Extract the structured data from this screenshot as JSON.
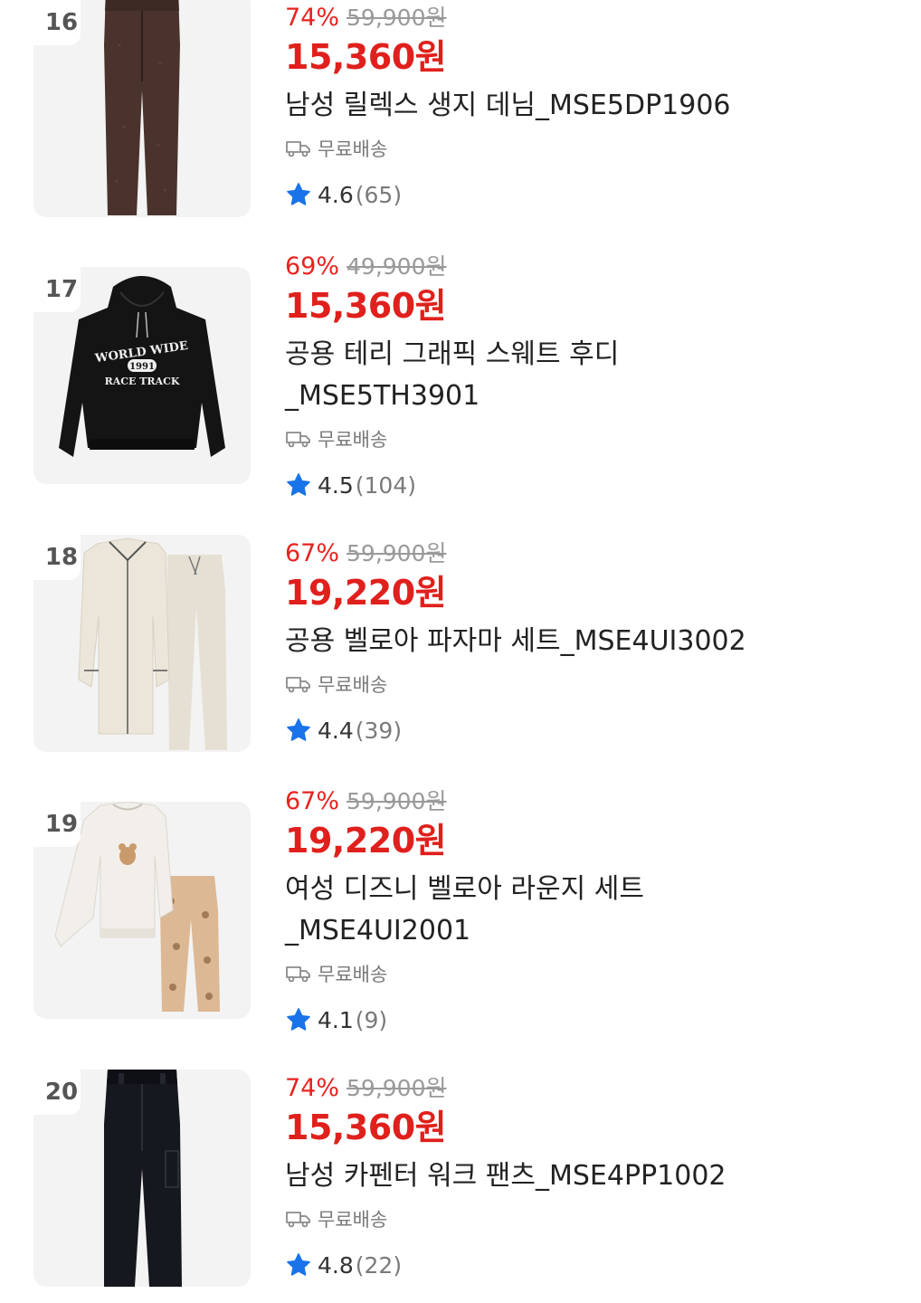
{
  "colors": {
    "discount": "#e8231f",
    "sale_price": "#e0201c",
    "star": "#1a73e8"
  },
  "products": [
    {
      "rank": "16",
      "discount": "74%",
      "original_price": "59,900원",
      "sale_price": "15,360원",
      "name_line1": "남성 릴렉스 생지 데님_MSE5DP1906",
      "name_line2": "",
      "shipping": "무료배송",
      "rating": "4.6",
      "review_count": "(65)",
      "image_icon": "brown-jeans"
    },
    {
      "rank": "17",
      "discount": "69%",
      "original_price": "49,900원",
      "sale_price": "15,360원",
      "name_line1": "공용 테리 그래픽 스웨트 후디",
      "name_line2": "_MSE5TH3901",
      "shipping": "무료배송",
      "rating": "4.5",
      "review_count": "(104)",
      "image_icon": "black-hoodie",
      "image_text": [
        "WORLD WIDE",
        "1991",
        "RACE TRACK"
      ]
    },
    {
      "rank": "18",
      "discount": "67%",
      "original_price": "59,900원",
      "sale_price": "19,220원",
      "name_line1": "공용 벨로아 파자마 세트_MSE4UI3002",
      "name_line2": "",
      "shipping": "무료배송",
      "rating": "4.4",
      "review_count": "(39)",
      "image_icon": "ivory-pajama-set"
    },
    {
      "rank": "19",
      "discount": "67%",
      "original_price": "59,900원",
      "sale_price": "19,220원",
      "name_line1": "여성 디즈니 벨로아 라운지 세트",
      "name_line2": "_MSE4UI2001",
      "shipping": "무료배송",
      "rating": "4.1",
      "review_count": "(9)",
      "image_icon": "lounge-set"
    },
    {
      "rank": "20",
      "discount": "74%",
      "original_price": "59,900원",
      "sale_price": "15,360원",
      "name_line1": "남성 카펜터 워크 팬츠_MSE4PP1002",
      "name_line2": "",
      "shipping": "무료배송",
      "rating": "4.8",
      "review_count": "(22)",
      "image_icon": "black-work-pants"
    }
  ]
}
